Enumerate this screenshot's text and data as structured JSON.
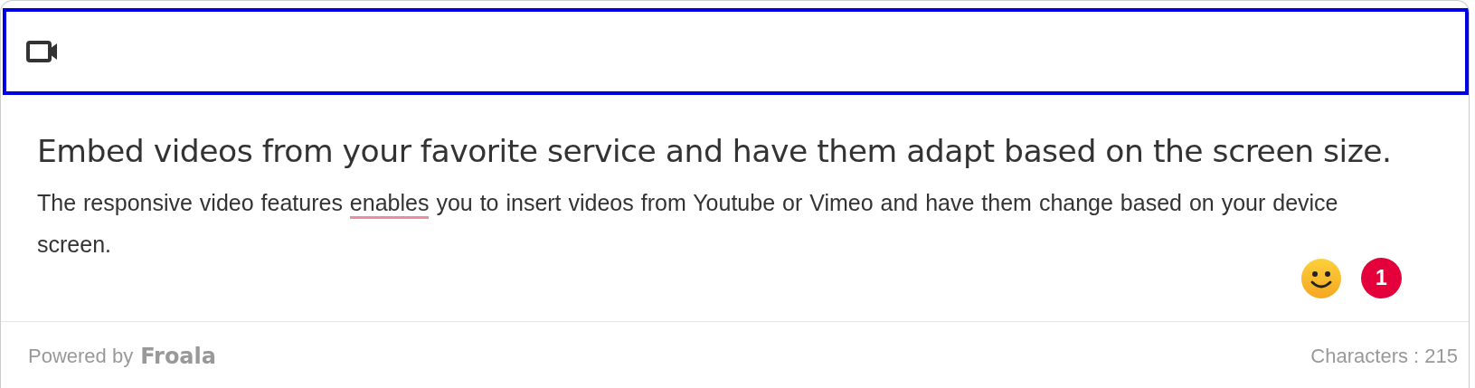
{
  "toolbar": {
    "highlighted": true
  },
  "heading": "Embed videos from your favorite service and have them adapt based on the screen size.",
  "paragraph": [
    {
      "text": "The responsive video features ",
      "flagged": false
    },
    {
      "text": "enables",
      "flagged": true
    },
    {
      "text": " you to insert videos from Youtube or Vimeo and have them change based on your device screen.",
      "flagged": false
    }
  ],
  "notification_badge": "1",
  "footer": {
    "powered_by": "Powered by",
    "brand": "Froala",
    "counter": "Characters : 215"
  }
}
